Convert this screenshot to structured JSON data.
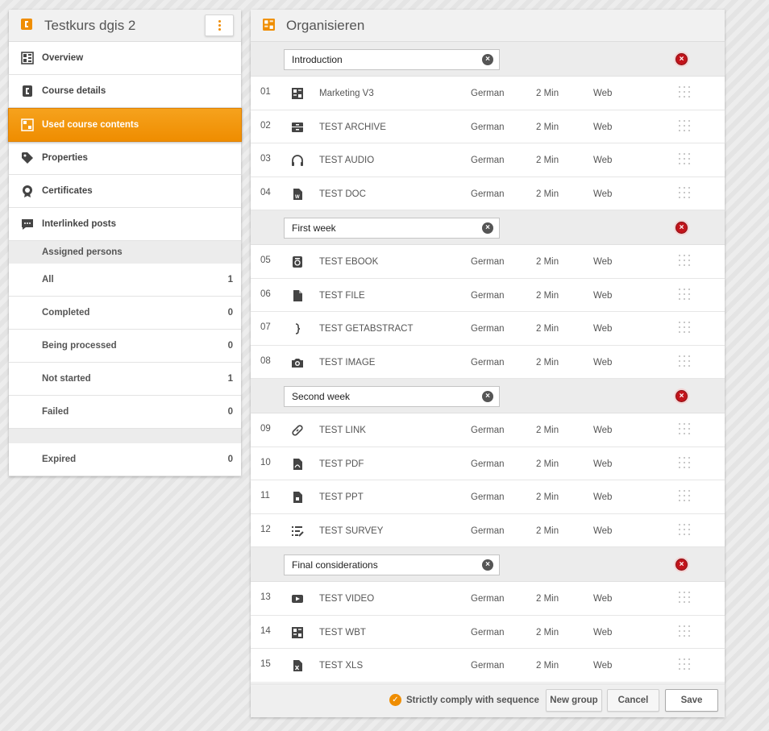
{
  "left_panel": {
    "title": "Testkurs dgis 2",
    "nav": [
      {
        "label": "Overview",
        "icon": "overview-icon"
      },
      {
        "label": "Course details",
        "icon": "course-details-icon"
      },
      {
        "label": "Used course contents",
        "icon": "course-contents-icon",
        "active": true
      },
      {
        "label": "Properties",
        "icon": "tag-icon"
      },
      {
        "label": "Certificates",
        "icon": "certificate-icon"
      },
      {
        "label": "Interlinked posts",
        "icon": "chat-icon"
      }
    ],
    "assigned_header": "Assigned persons",
    "stats": [
      {
        "label": "All",
        "count": "1"
      },
      {
        "label": "Completed",
        "count": "0"
      },
      {
        "label": "Being processed",
        "count": "0"
      },
      {
        "label": "Not started",
        "count": "1"
      },
      {
        "label": "Failed",
        "count": "0"
      }
    ],
    "expired": {
      "label": "Expired",
      "count": "0"
    }
  },
  "right_panel": {
    "title": "Organisieren",
    "groups": [
      {
        "name": "Introduction",
        "items": [
          {
            "num": "01",
            "title": "Marketing V3",
            "lang": "German",
            "duration": "2 Min",
            "type": "Web",
            "icon": "wbt-icon"
          },
          {
            "num": "02",
            "title": "TEST ARCHIVE",
            "lang": "German",
            "duration": "2 Min",
            "type": "Web",
            "icon": "archive-icon"
          },
          {
            "num": "03",
            "title": "TEST AUDIO",
            "lang": "German",
            "duration": "2 Min",
            "type": "Web",
            "icon": "headphones-icon"
          },
          {
            "num": "04",
            "title": "TEST DOC",
            "lang": "German",
            "duration": "2 Min",
            "type": "Web",
            "icon": "doc-icon"
          }
        ]
      },
      {
        "name": "First week",
        "items": [
          {
            "num": "05",
            "title": "TEST EBOOK",
            "lang": "German",
            "duration": "2 Min",
            "type": "Web",
            "icon": "ebook-icon"
          },
          {
            "num": "06",
            "title": "TEST FILE",
            "lang": "German",
            "duration": "2 Min",
            "type": "Web",
            "icon": "file-icon"
          },
          {
            "num": "07",
            "title": "TEST GETABSTRACT",
            "lang": "German",
            "duration": "2 Min",
            "type": "Web",
            "icon": "brace-icon"
          },
          {
            "num": "08",
            "title": "TEST IMAGE",
            "lang": "German",
            "duration": "2 Min",
            "type": "Web",
            "icon": "camera-icon"
          }
        ]
      },
      {
        "name": "Second week",
        "items": [
          {
            "num": "09",
            "title": "TEST LINK",
            "lang": "German",
            "duration": "2 Min",
            "type": "Web",
            "icon": "link-icon"
          },
          {
            "num": "10",
            "title": "TEST PDF",
            "lang": "German",
            "duration": "2 Min",
            "type": "Web",
            "icon": "pdf-icon"
          },
          {
            "num": "11",
            "title": "TEST PPT",
            "lang": "German",
            "duration": "2 Min",
            "type": "Web",
            "icon": "ppt-icon"
          },
          {
            "num": "12",
            "title": "TEST SURVEY",
            "lang": "German",
            "duration": "2 Min",
            "type": "Web",
            "icon": "survey-icon"
          }
        ]
      },
      {
        "name": "Final considerations",
        "items": [
          {
            "num": "13",
            "title": "TEST VIDEO",
            "lang": "German",
            "duration": "2 Min",
            "type": "Web",
            "icon": "video-icon"
          },
          {
            "num": "14",
            "title": "TEST WBT",
            "lang": "German",
            "duration": "2 Min",
            "type": "Web",
            "icon": "wbt-icon"
          },
          {
            "num": "15",
            "title": "TEST XLS",
            "lang": "German",
            "duration": "2 Min",
            "type": "Web",
            "icon": "xls-icon"
          }
        ]
      }
    ],
    "footer": {
      "sequence_label": "Strictly comply with sequence",
      "sequence_checked": true,
      "new_group": "New group",
      "cancel": "Cancel",
      "save": "Save"
    }
  },
  "colors": {
    "accent": "#ef8d00",
    "delete": "#c2141b",
    "panel_header": "#f1f1f1"
  }
}
